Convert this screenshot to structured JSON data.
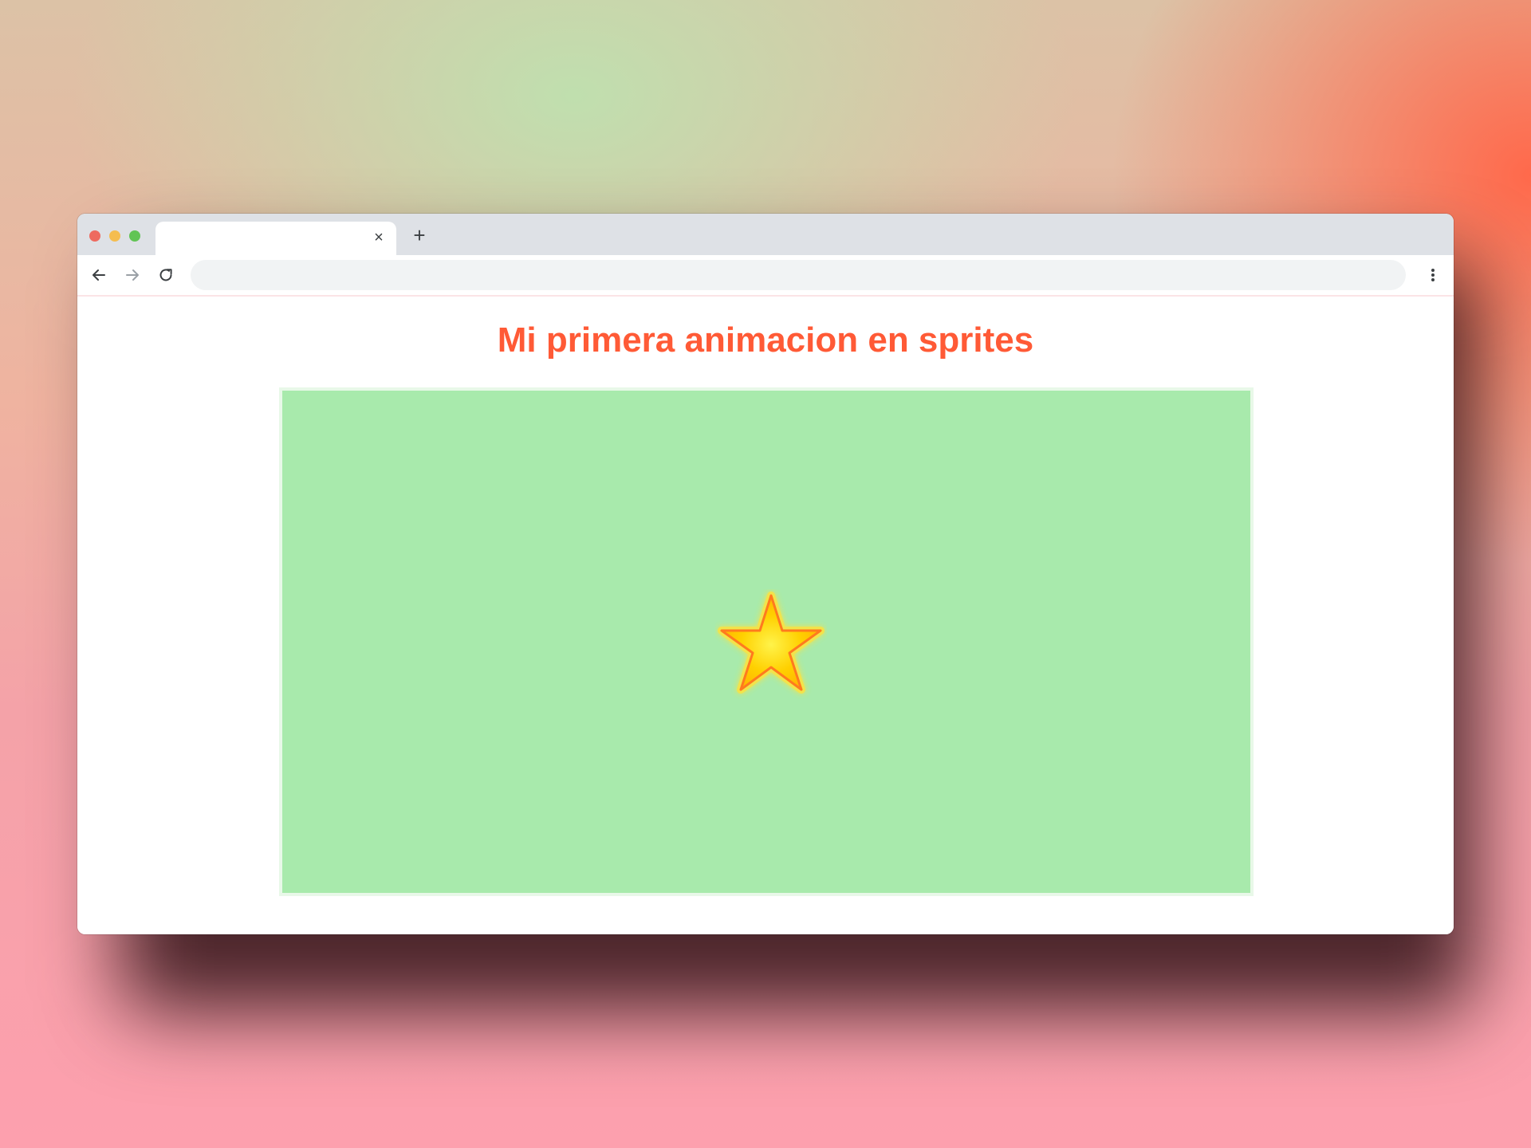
{
  "browser": {
    "tab": {
      "title": ""
    },
    "address_bar": {
      "value": "",
      "placeholder": ""
    }
  },
  "page": {
    "title": "Mi primera animacion en sprites"
  },
  "colors": {
    "title": "#ff5a36",
    "stage_background": "#a8eaac",
    "star_fill": "#ffe000",
    "star_outline": "#ff8a1e"
  },
  "icons": {
    "close": "close-icon",
    "new_tab": "plus-icon",
    "back": "arrow-left-icon",
    "forward": "arrow-right-icon",
    "reload": "reload-icon",
    "menu": "kebab-menu-icon",
    "sprite": "star-icon"
  }
}
